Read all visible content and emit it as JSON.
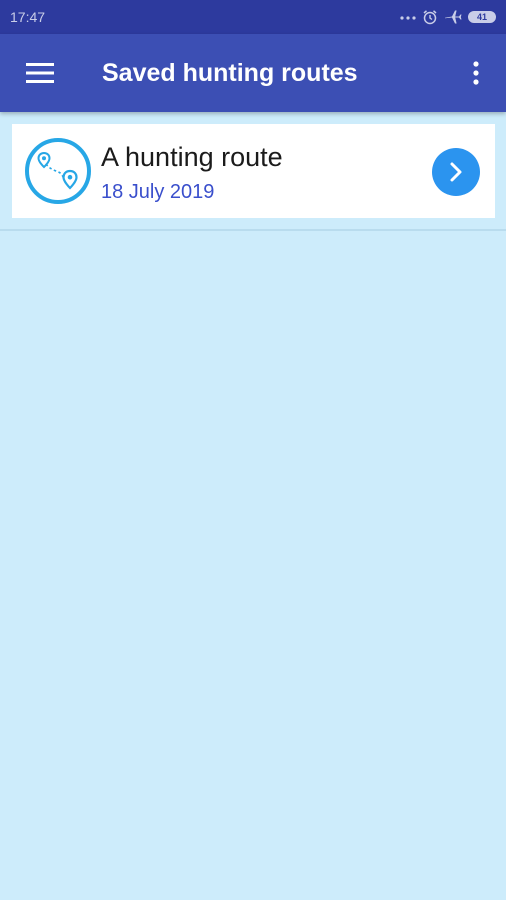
{
  "status_bar": {
    "time": "17:47",
    "battery_level": "41",
    "icons": [
      "more-dots-icon",
      "alarm-icon",
      "airplane-mode-icon",
      "battery-icon"
    ]
  },
  "app_bar": {
    "title": "Saved hunting routes",
    "menu_icon": "hamburger-menu-icon",
    "overflow_icon": "more-vert-icon"
  },
  "routes": [
    {
      "name": "A hunting route",
      "date": "18 July 2019",
      "icon": "route-map-pins-icon",
      "action_icon": "chevron-right-icon"
    }
  ],
  "colors": {
    "status_bar": "#2d3a9e",
    "app_bar": "#3c4fb4",
    "background": "#cdecfb",
    "accent_blue": "#2b94ef",
    "date_text": "#3a4fcc"
  }
}
